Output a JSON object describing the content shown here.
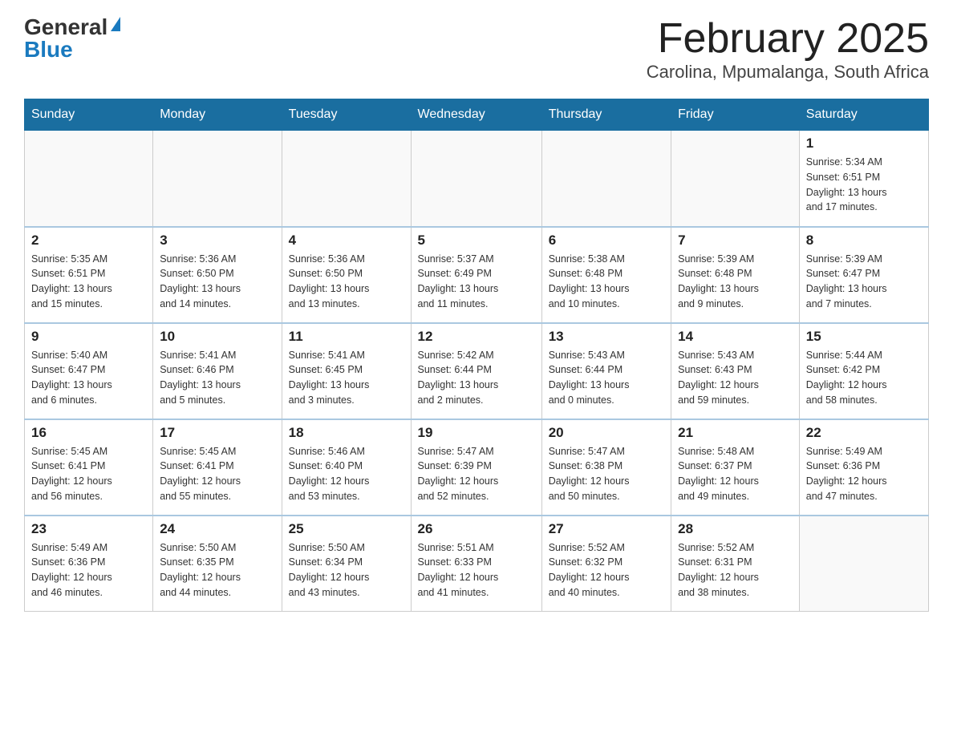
{
  "logo": {
    "general": "General",
    "blue": "Blue",
    "arrow": "▶"
  },
  "title": "February 2025",
  "location": "Carolina, Mpumalanga, South Africa",
  "days_of_week": [
    "Sunday",
    "Monday",
    "Tuesday",
    "Wednesday",
    "Thursday",
    "Friday",
    "Saturday"
  ],
  "weeks": [
    [
      {
        "day": "",
        "info": ""
      },
      {
        "day": "",
        "info": ""
      },
      {
        "day": "",
        "info": ""
      },
      {
        "day": "",
        "info": ""
      },
      {
        "day": "",
        "info": ""
      },
      {
        "day": "",
        "info": ""
      },
      {
        "day": "1",
        "info": "Sunrise: 5:34 AM\nSunset: 6:51 PM\nDaylight: 13 hours\nand 17 minutes."
      }
    ],
    [
      {
        "day": "2",
        "info": "Sunrise: 5:35 AM\nSunset: 6:51 PM\nDaylight: 13 hours\nand 15 minutes."
      },
      {
        "day": "3",
        "info": "Sunrise: 5:36 AM\nSunset: 6:50 PM\nDaylight: 13 hours\nand 14 minutes."
      },
      {
        "day": "4",
        "info": "Sunrise: 5:36 AM\nSunset: 6:50 PM\nDaylight: 13 hours\nand 13 minutes."
      },
      {
        "day": "5",
        "info": "Sunrise: 5:37 AM\nSunset: 6:49 PM\nDaylight: 13 hours\nand 11 minutes."
      },
      {
        "day": "6",
        "info": "Sunrise: 5:38 AM\nSunset: 6:48 PM\nDaylight: 13 hours\nand 10 minutes."
      },
      {
        "day": "7",
        "info": "Sunrise: 5:39 AM\nSunset: 6:48 PM\nDaylight: 13 hours\nand 9 minutes."
      },
      {
        "day": "8",
        "info": "Sunrise: 5:39 AM\nSunset: 6:47 PM\nDaylight: 13 hours\nand 7 minutes."
      }
    ],
    [
      {
        "day": "9",
        "info": "Sunrise: 5:40 AM\nSunset: 6:47 PM\nDaylight: 13 hours\nand 6 minutes."
      },
      {
        "day": "10",
        "info": "Sunrise: 5:41 AM\nSunset: 6:46 PM\nDaylight: 13 hours\nand 5 minutes."
      },
      {
        "day": "11",
        "info": "Sunrise: 5:41 AM\nSunset: 6:45 PM\nDaylight: 13 hours\nand 3 minutes."
      },
      {
        "day": "12",
        "info": "Sunrise: 5:42 AM\nSunset: 6:44 PM\nDaylight: 13 hours\nand 2 minutes."
      },
      {
        "day": "13",
        "info": "Sunrise: 5:43 AM\nSunset: 6:44 PM\nDaylight: 13 hours\nand 0 minutes."
      },
      {
        "day": "14",
        "info": "Sunrise: 5:43 AM\nSunset: 6:43 PM\nDaylight: 12 hours\nand 59 minutes."
      },
      {
        "day": "15",
        "info": "Sunrise: 5:44 AM\nSunset: 6:42 PM\nDaylight: 12 hours\nand 58 minutes."
      }
    ],
    [
      {
        "day": "16",
        "info": "Sunrise: 5:45 AM\nSunset: 6:41 PM\nDaylight: 12 hours\nand 56 minutes."
      },
      {
        "day": "17",
        "info": "Sunrise: 5:45 AM\nSunset: 6:41 PM\nDaylight: 12 hours\nand 55 minutes."
      },
      {
        "day": "18",
        "info": "Sunrise: 5:46 AM\nSunset: 6:40 PM\nDaylight: 12 hours\nand 53 minutes."
      },
      {
        "day": "19",
        "info": "Sunrise: 5:47 AM\nSunset: 6:39 PM\nDaylight: 12 hours\nand 52 minutes."
      },
      {
        "day": "20",
        "info": "Sunrise: 5:47 AM\nSunset: 6:38 PM\nDaylight: 12 hours\nand 50 minutes."
      },
      {
        "day": "21",
        "info": "Sunrise: 5:48 AM\nSunset: 6:37 PM\nDaylight: 12 hours\nand 49 minutes."
      },
      {
        "day": "22",
        "info": "Sunrise: 5:49 AM\nSunset: 6:36 PM\nDaylight: 12 hours\nand 47 minutes."
      }
    ],
    [
      {
        "day": "23",
        "info": "Sunrise: 5:49 AM\nSunset: 6:36 PM\nDaylight: 12 hours\nand 46 minutes."
      },
      {
        "day": "24",
        "info": "Sunrise: 5:50 AM\nSunset: 6:35 PM\nDaylight: 12 hours\nand 44 minutes."
      },
      {
        "day": "25",
        "info": "Sunrise: 5:50 AM\nSunset: 6:34 PM\nDaylight: 12 hours\nand 43 minutes."
      },
      {
        "day": "26",
        "info": "Sunrise: 5:51 AM\nSunset: 6:33 PM\nDaylight: 12 hours\nand 41 minutes."
      },
      {
        "day": "27",
        "info": "Sunrise: 5:52 AM\nSunset: 6:32 PM\nDaylight: 12 hours\nand 40 minutes."
      },
      {
        "day": "28",
        "info": "Sunrise: 5:52 AM\nSunset: 6:31 PM\nDaylight: 12 hours\nand 38 minutes."
      },
      {
        "day": "",
        "info": ""
      }
    ]
  ]
}
